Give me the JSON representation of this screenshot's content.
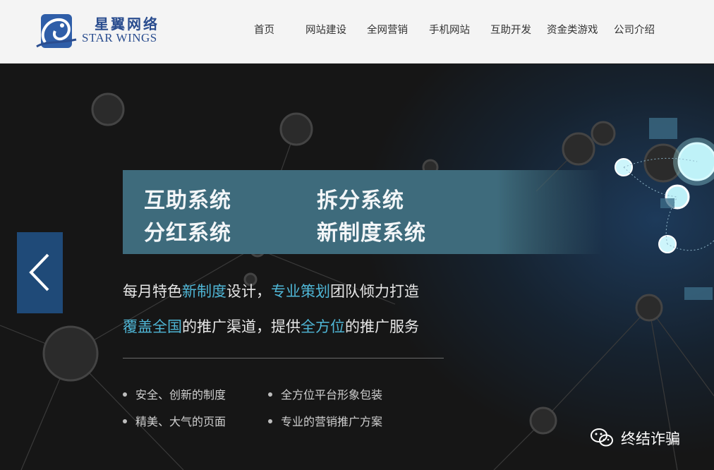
{
  "logo": {
    "cn_name": "星翼网络",
    "en_name": "STAR WINGS"
  },
  "nav": {
    "items": [
      "首页",
      "网站建设",
      "全网营销",
      "手机网站",
      "互助开发",
      "资金类游戏",
      "公司介绍"
    ]
  },
  "banner": {
    "items": [
      "互助系统",
      "拆分系统",
      "分红系统",
      "新制度系统"
    ]
  },
  "tagline": {
    "line1": [
      "每月特色",
      "新制度",
      "设计，",
      "专业策划",
      "团队倾力打造"
    ],
    "line2": [
      "覆盖全国",
      "的推广渠道，提供",
      "全方位",
      "的推广服务"
    ]
  },
  "features": [
    "安全、创新的制度",
    "全方位平台形象包装",
    "精美、大气的页面",
    "专业的营销推广方案"
  ],
  "watermark": {
    "text": "终结诈骗"
  },
  "colors": {
    "highlight": "#4fb6d6",
    "banner": "#3e6b7c",
    "arrow_bg": "#1f4a78",
    "logo_blue": "#2a4d8f"
  },
  "icons": {
    "prev": "chevron-left-icon",
    "logo": "swirl-logo-icon",
    "watermark": "wechat-icon"
  }
}
